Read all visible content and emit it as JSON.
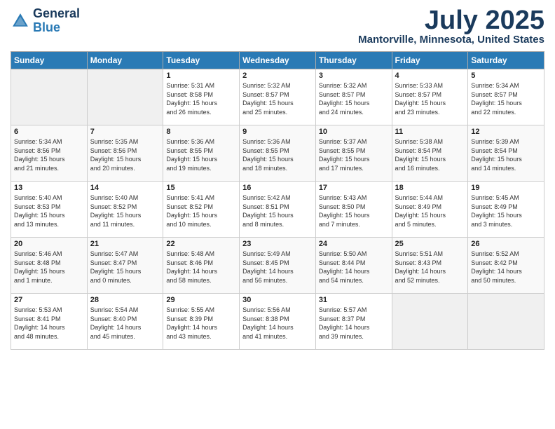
{
  "header": {
    "logo_general": "General",
    "logo_blue": "Blue",
    "month_title": "July 2025",
    "location": "Mantorville, Minnesota, United States"
  },
  "days_of_week": [
    "Sunday",
    "Monday",
    "Tuesday",
    "Wednesday",
    "Thursday",
    "Friday",
    "Saturday"
  ],
  "weeks": [
    [
      {
        "day": "",
        "info": ""
      },
      {
        "day": "",
        "info": ""
      },
      {
        "day": "1",
        "info": "Sunrise: 5:31 AM\nSunset: 8:58 PM\nDaylight: 15 hours\nand 26 minutes."
      },
      {
        "day": "2",
        "info": "Sunrise: 5:32 AM\nSunset: 8:57 PM\nDaylight: 15 hours\nand 25 minutes."
      },
      {
        "day": "3",
        "info": "Sunrise: 5:32 AM\nSunset: 8:57 PM\nDaylight: 15 hours\nand 24 minutes."
      },
      {
        "day": "4",
        "info": "Sunrise: 5:33 AM\nSunset: 8:57 PM\nDaylight: 15 hours\nand 23 minutes."
      },
      {
        "day": "5",
        "info": "Sunrise: 5:34 AM\nSunset: 8:57 PM\nDaylight: 15 hours\nand 22 minutes."
      }
    ],
    [
      {
        "day": "6",
        "info": "Sunrise: 5:34 AM\nSunset: 8:56 PM\nDaylight: 15 hours\nand 21 minutes."
      },
      {
        "day": "7",
        "info": "Sunrise: 5:35 AM\nSunset: 8:56 PM\nDaylight: 15 hours\nand 20 minutes."
      },
      {
        "day": "8",
        "info": "Sunrise: 5:36 AM\nSunset: 8:55 PM\nDaylight: 15 hours\nand 19 minutes."
      },
      {
        "day": "9",
        "info": "Sunrise: 5:36 AM\nSunset: 8:55 PM\nDaylight: 15 hours\nand 18 minutes."
      },
      {
        "day": "10",
        "info": "Sunrise: 5:37 AM\nSunset: 8:55 PM\nDaylight: 15 hours\nand 17 minutes."
      },
      {
        "day": "11",
        "info": "Sunrise: 5:38 AM\nSunset: 8:54 PM\nDaylight: 15 hours\nand 16 minutes."
      },
      {
        "day": "12",
        "info": "Sunrise: 5:39 AM\nSunset: 8:54 PM\nDaylight: 15 hours\nand 14 minutes."
      }
    ],
    [
      {
        "day": "13",
        "info": "Sunrise: 5:40 AM\nSunset: 8:53 PM\nDaylight: 15 hours\nand 13 minutes."
      },
      {
        "day": "14",
        "info": "Sunrise: 5:40 AM\nSunset: 8:52 PM\nDaylight: 15 hours\nand 11 minutes."
      },
      {
        "day": "15",
        "info": "Sunrise: 5:41 AM\nSunset: 8:52 PM\nDaylight: 15 hours\nand 10 minutes."
      },
      {
        "day": "16",
        "info": "Sunrise: 5:42 AM\nSunset: 8:51 PM\nDaylight: 15 hours\nand 8 minutes."
      },
      {
        "day": "17",
        "info": "Sunrise: 5:43 AM\nSunset: 8:50 PM\nDaylight: 15 hours\nand 7 minutes."
      },
      {
        "day": "18",
        "info": "Sunrise: 5:44 AM\nSunset: 8:49 PM\nDaylight: 15 hours\nand 5 minutes."
      },
      {
        "day": "19",
        "info": "Sunrise: 5:45 AM\nSunset: 8:49 PM\nDaylight: 15 hours\nand 3 minutes."
      }
    ],
    [
      {
        "day": "20",
        "info": "Sunrise: 5:46 AM\nSunset: 8:48 PM\nDaylight: 15 hours\nand 1 minute."
      },
      {
        "day": "21",
        "info": "Sunrise: 5:47 AM\nSunset: 8:47 PM\nDaylight: 15 hours\nand 0 minutes."
      },
      {
        "day": "22",
        "info": "Sunrise: 5:48 AM\nSunset: 8:46 PM\nDaylight: 14 hours\nand 58 minutes."
      },
      {
        "day": "23",
        "info": "Sunrise: 5:49 AM\nSunset: 8:45 PM\nDaylight: 14 hours\nand 56 minutes."
      },
      {
        "day": "24",
        "info": "Sunrise: 5:50 AM\nSunset: 8:44 PM\nDaylight: 14 hours\nand 54 minutes."
      },
      {
        "day": "25",
        "info": "Sunrise: 5:51 AM\nSunset: 8:43 PM\nDaylight: 14 hours\nand 52 minutes."
      },
      {
        "day": "26",
        "info": "Sunrise: 5:52 AM\nSunset: 8:42 PM\nDaylight: 14 hours\nand 50 minutes."
      }
    ],
    [
      {
        "day": "27",
        "info": "Sunrise: 5:53 AM\nSunset: 8:41 PM\nDaylight: 14 hours\nand 48 minutes."
      },
      {
        "day": "28",
        "info": "Sunrise: 5:54 AM\nSunset: 8:40 PM\nDaylight: 14 hours\nand 45 minutes."
      },
      {
        "day": "29",
        "info": "Sunrise: 5:55 AM\nSunset: 8:39 PM\nDaylight: 14 hours\nand 43 minutes."
      },
      {
        "day": "30",
        "info": "Sunrise: 5:56 AM\nSunset: 8:38 PM\nDaylight: 14 hours\nand 41 minutes."
      },
      {
        "day": "31",
        "info": "Sunrise: 5:57 AM\nSunset: 8:37 PM\nDaylight: 14 hours\nand 39 minutes."
      },
      {
        "day": "",
        "info": ""
      },
      {
        "day": "",
        "info": ""
      }
    ]
  ]
}
